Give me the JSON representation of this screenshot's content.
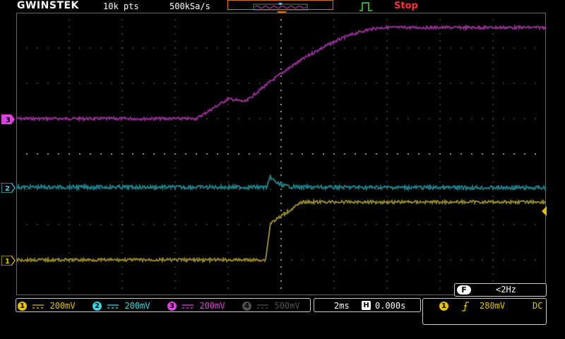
{
  "brand": {
    "name": "GWINSTEK"
  },
  "acquisition": {
    "record_length": "10k pts",
    "sample_rate": "500kSa/s",
    "run_state": "Stop"
  },
  "channels": [
    {
      "id": "1",
      "scale": "200mV",
      "color": "#e8c000",
      "trace_color": "#8c8020",
      "enabled": true
    },
    {
      "id": "2",
      "scale": "200mV",
      "color": "#30d8e8",
      "trace_color": "#1a7a80",
      "enabled": true
    },
    {
      "id": "3",
      "scale": "200mV",
      "color": "#e040e0",
      "trace_color": "#8a2a8a",
      "enabled": true
    },
    {
      "id": "4",
      "scale": "500mV",
      "color": "#505050",
      "trace_color": "#505050",
      "enabled": false
    }
  ],
  "timebase": {
    "scale": "2ms",
    "horizontal_icon": "H",
    "position": "0.000s"
  },
  "frequency": {
    "icon": "F",
    "value": "<2Hz"
  },
  "trigger": {
    "source": "1",
    "slope_icon": "rising-edge-icon",
    "level": "280mV",
    "coupling": "DC"
  },
  "colors": {
    "accent": "#e07000",
    "stop": "#ff3030",
    "trigger_marker": "#e8c000"
  }
}
